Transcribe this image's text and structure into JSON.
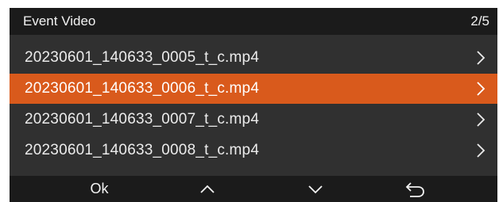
{
  "header": {
    "title": "Event Video",
    "page_indicator": "2/5"
  },
  "files": [
    {
      "name": "20230601_140633_0005_t_c.mp4",
      "selected": false,
      "icon": "chevron-right-icon"
    },
    {
      "name": "20230601_140633_0006_t_c.mp4",
      "selected": true,
      "icon": "chevron-right-icon"
    },
    {
      "name": "20230601_140633_0007_t_c.mp4",
      "selected": false,
      "icon": "chevron-right-icon"
    },
    {
      "name": "20230601_140633_0008_t_c.mp4",
      "selected": false,
      "icon": "chevron-right-icon"
    }
  ],
  "footer": {
    "ok_label": "Ok",
    "up_icon": "chevron-up-icon",
    "down_icon": "chevron-down-icon",
    "back_icon": "return-arrow-icon"
  },
  "colors": {
    "header_bg": "#1b1b1b",
    "list_bg": "#303030",
    "selected_bg": "#d95a1c",
    "text": "#ececec"
  }
}
